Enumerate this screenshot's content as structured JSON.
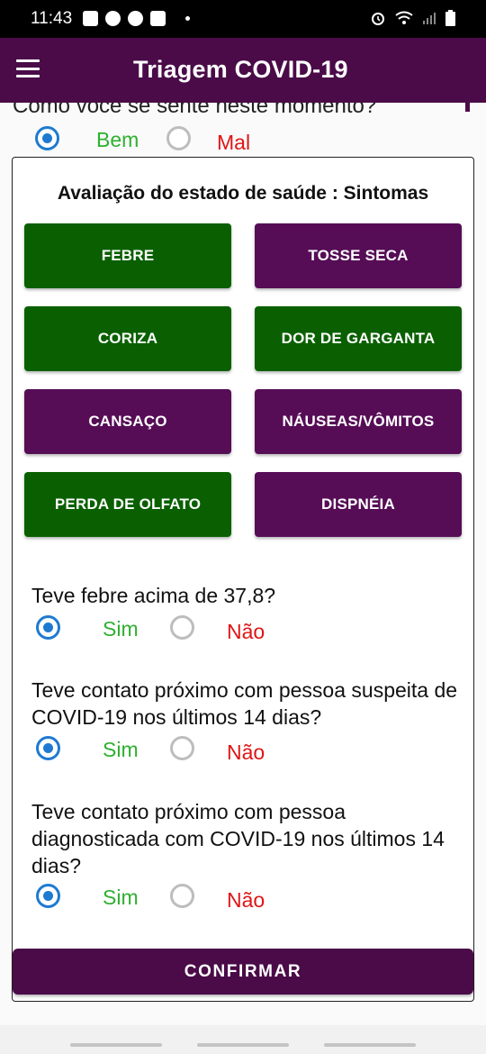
{
  "status_bar": {
    "time": "11:43",
    "left_icons": [
      "sim-card-icon",
      "account-icon",
      "app-icon",
      "camera-icon",
      "dot-icon"
    ],
    "right_icons": [
      "alarm-icon",
      "wifi-icon",
      "signal-icon",
      "battery-icon"
    ]
  },
  "app_bar": {
    "title": "Triagem COVID-19",
    "menu_icon": "menu-icon"
  },
  "mood": {
    "question": "Como você se sente neste momento?",
    "yes_label": "Bem",
    "no_label": "Mal",
    "selected": "Bem"
  },
  "symptoms": {
    "title": "Avaliação do estado de saúde : Sintomas",
    "buttons": [
      {
        "label": "FEBRE",
        "state": "selected",
        "color": "#0a6000"
      },
      {
        "label": "TOSSE SECA",
        "state": "unselected",
        "color": "#560d56"
      },
      {
        "label": "CORIZA",
        "state": "selected",
        "color": "#0a6000"
      },
      {
        "label": "DOR DE GARGANTA",
        "state": "selected",
        "color": "#0a6000"
      },
      {
        "label": "CANSAÇO",
        "state": "unselected",
        "color": "#560d56"
      },
      {
        "label": "NÁUSEAS/VÔMITOS",
        "state": "unselected",
        "color": "#560d56"
      },
      {
        "label": "PERDA DE OLFATO",
        "state": "selected",
        "color": "#0a6000"
      },
      {
        "label": "DISPNÉIA",
        "state": "unselected",
        "color": "#560d56"
      }
    ]
  },
  "questions": [
    {
      "text": "Teve febre acima de 37,8?",
      "yes_label": "Sim",
      "no_label": "Não",
      "selected": "Sim"
    },
    {
      "text": "Teve contato próximo com pessoa suspeita de COVID-19 nos últimos 14 dias?",
      "yes_label": "Sim",
      "no_label": "Não",
      "selected": "Sim"
    },
    {
      "text": "Teve contato próximo com pessoa diagnosticada com COVID-19 nos últimos 14 dias?",
      "yes_label": "Sim",
      "no_label": "Não",
      "selected": "Sim"
    }
  ],
  "confirm_label": "CONFIRMAR",
  "colors": {
    "primary": "#4a0b48",
    "selected_green": "#0a6000",
    "unselected_purple": "#560d56",
    "yes_text": "#2fb030",
    "no_text": "#e01515",
    "radio_checked": "#1e7ad1"
  }
}
